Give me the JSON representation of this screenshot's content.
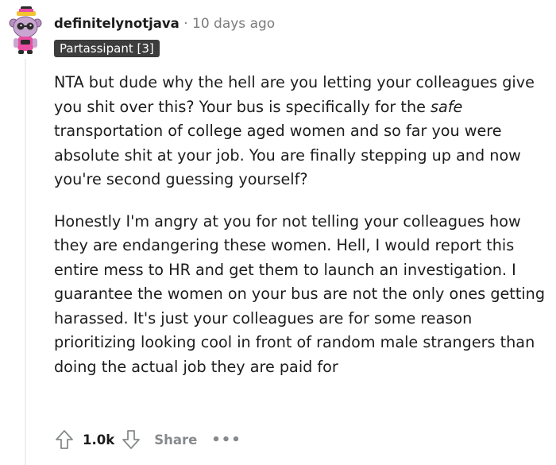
{
  "comment": {
    "username": "definitelynotjava",
    "separator": "·",
    "timestamp": "10 days ago",
    "flair": "Partassipant [3]",
    "paragraph1": {
      "before_em": "NTA but dude why the hell are you letting your colleagues give you shit over this? Your bus is specifically for the ",
      "em": "safe",
      "after_em": " transportation of college aged women and so far you were absolute shit at your job. You are finally stepping up and now you're second guessing yourself?"
    },
    "paragraph2": "Honestly I'm angry at you for not telling your colleagues how they are endangering these women. Hell, I would report this entire mess to HR and get them to launch an investigation. I guarantee the women on your bus are not the only ones getting harassed. It's just your colleagues are for some reason prioritizing looking cool in front of random male strangers than doing the actual job they are paid for"
  },
  "actions": {
    "upvote_icon": "arrow-up-icon",
    "score": "1.0k",
    "downvote_icon": "arrow-down-icon",
    "share_label": "Share",
    "more_label": "•••"
  },
  "colors": {
    "text": "#1c1c1c",
    "muted": "#7c7c7c",
    "flair_bg": "#3d3d3d",
    "avatar_pink": "#e84fa2",
    "avatar_purple": "#b98fc2"
  }
}
